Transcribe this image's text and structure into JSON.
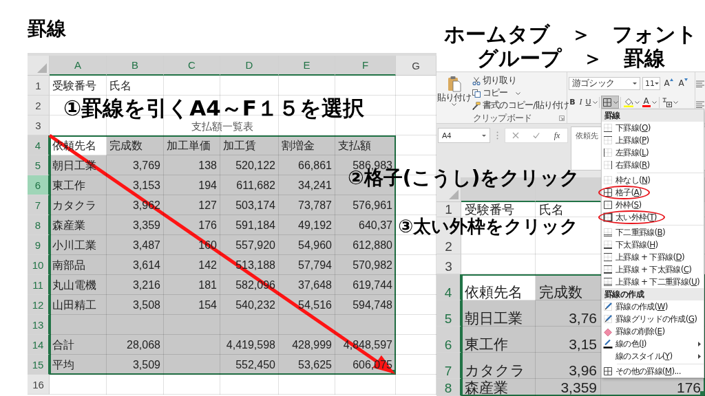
{
  "title": "罫線",
  "instructions": [
    "ホームタブ　＞　フォント",
    "グループ　＞　罫線"
  ],
  "sheets": [
    {
      "columns": [
        {
          "label": "A",
          "selected": true
        },
        {
          "label": "B",
          "selected": true
        },
        {
          "label": "C",
          "selected": true
        },
        {
          "label": "D",
          "selected": true
        },
        {
          "label": "E",
          "selected": true
        },
        {
          "label": "F",
          "selected": true
        },
        {
          "label": "G",
          "selected": false
        }
      ],
      "rows": [
        {
          "label": "1",
          "kind": "text",
          "selected": false,
          "highlighted": false,
          "active": false,
          "cells": [
            "受験番号",
            "氏名"
          ]
        },
        {
          "label": "2",
          "kind": "text",
          "selected": false,
          "highlighted": false,
          "active": false
        },
        {
          "label": "3",
          "kind": "title",
          "selected": false,
          "highlighted": false,
          "active": false,
          "cells": [
            "支払額一覧表"
          ]
        },
        {
          "label": "4",
          "kind": "text",
          "selected": true,
          "highlighted": false,
          "active": true,
          "cells": [
            "依頼先名",
            "完成数",
            "加工単価",
            "加工賃",
            "割増金",
            "支払額"
          ]
        },
        {
          "label": "5",
          "kind": "data",
          "selected": true,
          "highlighted": false,
          "active": false,
          "cells": [
            "朝日工業",
            "3,769",
            "138",
            "520,122",
            "66,861",
            "586,983"
          ]
        },
        {
          "label": "6",
          "kind": "data",
          "selected": true,
          "highlighted": true,
          "active": false,
          "cells": [
            "東工作",
            "3,153",
            "194",
            "611,682",
            "34,241"
          ]
        },
        {
          "label": "7",
          "kind": "data",
          "selected": true,
          "highlighted": false,
          "active": false,
          "cells": [
            "カタクラ",
            "3,962",
            "127",
            "503,174",
            "73,787",
            "576,961"
          ]
        },
        {
          "label": "8",
          "kind": "data",
          "selected": true,
          "highlighted": false,
          "active": false,
          "cells": [
            "森産業",
            "3,359",
            "176",
            "591,184",
            "49,192",
            "640,37"
          ]
        },
        {
          "label": "9",
          "kind": "data",
          "selected": true,
          "highlighted": false,
          "active": false,
          "cells": [
            "小川工業",
            "3,487",
            "160",
            "557,920",
            "54,960",
            "612,880"
          ]
        },
        {
          "label": "10",
          "kind": "data",
          "selected": true,
          "highlighted": false,
          "active": false,
          "cells": [
            "南部品",
            "3,614",
            "142",
            "513,188",
            "57,794",
            "570,982"
          ]
        },
        {
          "label": "11",
          "kind": "data",
          "selected": true,
          "highlighted": false,
          "active": false,
          "cells": [
            "丸山電機",
            "3,216",
            "181",
            "582,096",
            "37,648",
            "619,744"
          ]
        },
        {
          "label": "12",
          "kind": "data",
          "selected": true,
          "highlighted": false,
          "active": false,
          "cells": [
            "山田精工",
            "3,508",
            "154",
            "540,232",
            "54,516",
            "594,748"
          ]
        },
        {
          "label": "13",
          "kind": "data",
          "selected": true,
          "highlighted": false,
          "active": false
        },
        {
          "label": "14",
          "kind": "data",
          "selected": true,
          "highlighted": false,
          "active": false,
          "cells": [
            "合計",
            "28,068",
            null,
            "4,419,598",
            "428,999",
            "4,848,597"
          ]
        },
        {
          "label": "15",
          "kind": "data",
          "selected": true,
          "highlighted": false,
          "active": false,
          "cells": [
            "平均",
            "3,509",
            null,
            "552,450",
            "53,625",
            "606,075"
          ]
        },
        {
          "label": "16",
          "kind": "text",
          "selected": false,
          "highlighted": false,
          "active": false
        }
      ]
    },
    {
      "columns": [
        {
          "selected": true
        },
        {
          "selected": true
        }
      ],
      "rows": [
        {
          "label": "1",
          "kind": "text",
          "selected": false,
          "highlighted": false,
          "active": false,
          "cells": [
            "受験番号",
            "氏名"
          ]
        },
        {
          "label": "2",
          "kind": "text",
          "selected": false,
          "highlighted": false,
          "active": false
        },
        {
          "label": "3",
          "kind": "text",
          "selected": false,
          "highlighted": false,
          "active": false
        },
        {
          "label": "4",
          "kind": "text",
          "selected": true,
          "highlighted": false,
          "active": true,
          "cells": [
            "依頼先名",
            "完成数"
          ]
        },
        {
          "label": "5",
          "kind": "data",
          "selected": true,
          "highlighted": false,
          "active": false,
          "cells": [
            "朝日工業",
            "3,76"
          ]
        },
        {
          "label": "6",
          "kind": "data",
          "selected": true,
          "highlighted": false,
          "active": false,
          "cells": [
            "東工作",
            "3,15"
          ]
        },
        {
          "label": "7",
          "kind": "data",
          "selected": true,
          "highlighted": false,
          "active": false,
          "cells": [
            "カタクラ",
            "3,96"
          ]
        },
        {
          "label": "8",
          "kind": "data",
          "selected": true,
          "highlighted": false,
          "active": false,
          "cells": [
            "森産業",
            "3,359",
            "176"
          ]
        }
      ]
    }
  ],
  "window": {
    "ribbon": {
      "clipboard": {
        "paste": "貼り付け",
        "cut": "切り取り",
        "copy": "コピー",
        "format_painter": "書式のコピー/貼り付け",
        "group_label": "クリップボード"
      },
      "font": {
        "font_name": "游ゴシック",
        "font_size": "11",
        "grow": "A",
        "shrink": "A",
        "bold": "B",
        "italic": "I",
        "underline": "U",
        "font_color": "A",
        "borders_pressed": true
      }
    },
    "formula_bar": {
      "name_box": "A4",
      "function_label": "fx",
      "formula": "依頼先"
    }
  },
  "menu": {
    "sections": [
      {
        "title": "罫線",
        "groups": [
          [
            {
              "text": "下罫線(",
              "key": "O",
              "after": ")",
              "circled": false,
              "submenu": false
            },
            {
              "text": "上罫線(",
              "key": "P",
              "after": ")",
              "circled": false,
              "submenu": false
            },
            {
              "text": "左罫線(",
              "key": "L",
              "after": ")",
              "circled": false,
              "submenu": false
            },
            {
              "text": "右罫線(",
              "key": "R",
              "after": ")",
              "circled": false,
              "submenu": false
            }
          ],
          [
            {
              "text": "枠なし(",
              "key": "N",
              "after": ")",
              "circled": false,
              "submenu": false
            },
            {
              "text": "格子(",
              "key": "A",
              "after": ")",
              "circled": true,
              "submenu": false
            },
            {
              "text": "外枠(",
              "key": "S",
              "after": ")",
              "circled": false,
              "submenu": false
            },
            {
              "text": "太い外枠(",
              "key": "T",
              "after": ")",
              "circled": true,
              "submenu": false
            }
          ],
          [
            {
              "text": "下二重罫線(",
              "key": "B",
              "after": ")",
              "circled": false,
              "submenu": false
            },
            {
              "text": "下太罫線(",
              "key": "H",
              "after": ")",
              "circled": false,
              "submenu": false
            },
            {
              "text": "上罫線 + 下罫線(",
              "key": "D",
              "after": ")",
              "circled": false,
              "submenu": false
            },
            {
              "text": "上罫線 + 下太罫線(",
              "key": "C",
              "after": ")",
              "circled": false,
              "submenu": false
            },
            {
              "text": "上罫線 + 下二重罫線(",
              "key": "U",
              "after": ")",
              "circled": false,
              "submenu": false
            }
          ]
        ]
      },
      {
        "title": "罫線の作成",
        "groups": [
          [
            {
              "text": "罫線の作成(",
              "key": "W",
              "after": ")",
              "circled": false,
              "submenu": false
            },
            {
              "text": "罫線グリッドの作成(",
              "key": "G",
              "after": ")",
              "circled": false,
              "submenu": false
            },
            {
              "text": "罫線の削除(",
              "key": "E",
              "after": ")",
              "circled": false,
              "submenu": false
            },
            {
              "text": "線の色(",
              "key": "I",
              "after": ")",
              "circled": false,
              "submenu": true
            },
            {
              "text": "線のスタイル(",
              "key": "Y",
              "after": ")",
              "circled": false,
              "submenu": true
            }
          ],
          [
            {
              "text": "その他の罫線(",
              "key": "M",
              "after": ")...",
              "circled": false,
              "submenu": false
            }
          ]
        ]
      }
    ]
  },
  "annotations": [
    "①罫線を引くA4～F１５を選択",
    "②格子(こうし)をクリック",
    "③太い外枠をクリック"
  ]
}
